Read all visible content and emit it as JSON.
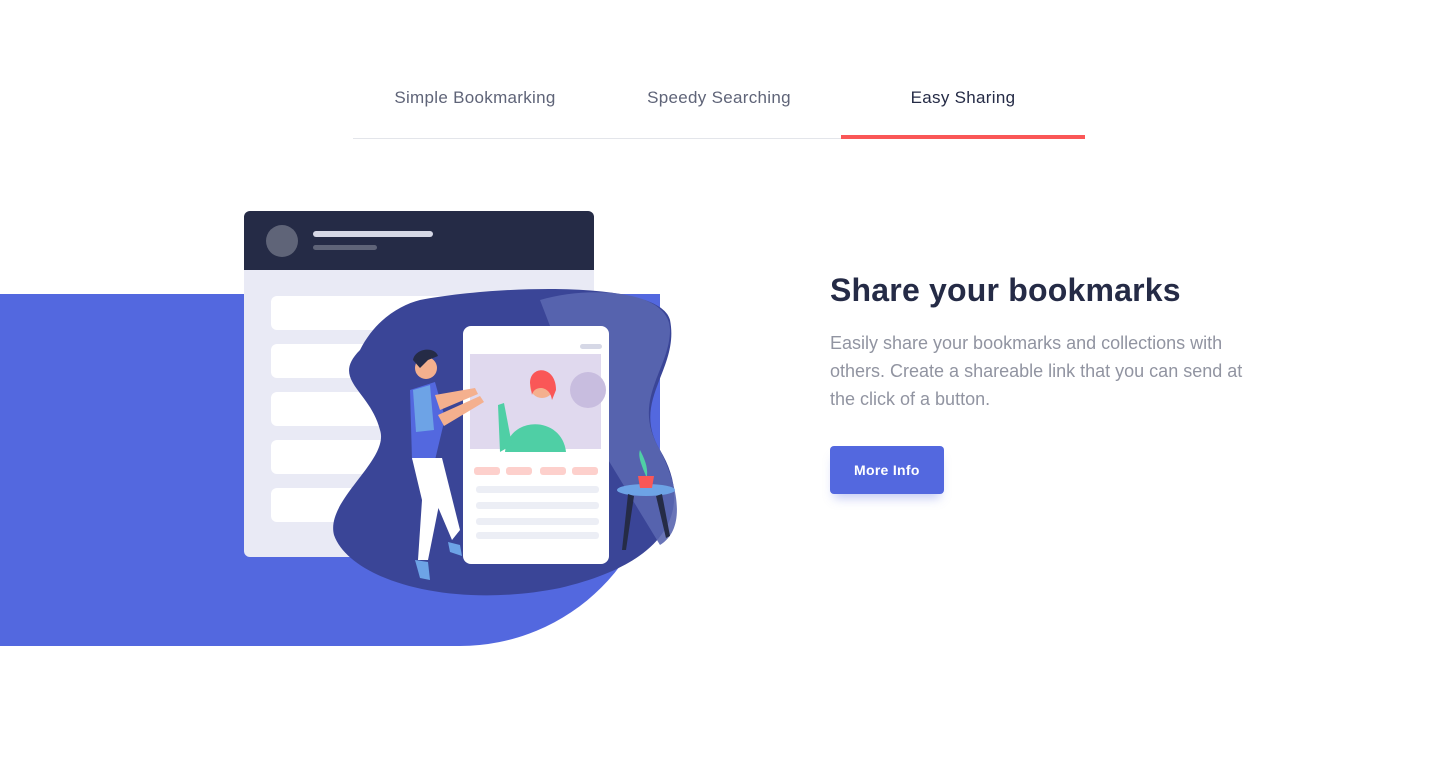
{
  "tabs": [
    {
      "label": "Simple Bookmarking",
      "active": false
    },
    {
      "label": "Speedy Searching",
      "active": false
    },
    {
      "label": "Easy Sharing",
      "active": true
    }
  ],
  "feature": {
    "title": "Share your bookmarks",
    "description": "Easily share your bookmarks and collections with others. Create a shareable link that you can send at the click of a button.",
    "button_label": "More Info"
  },
  "colors": {
    "accent": "#5368df",
    "tab_indicator": "#fa5757",
    "heading": "#252b46",
    "body_text": "#9194a1"
  },
  "illustration": {
    "name": "sharing-illustration"
  }
}
